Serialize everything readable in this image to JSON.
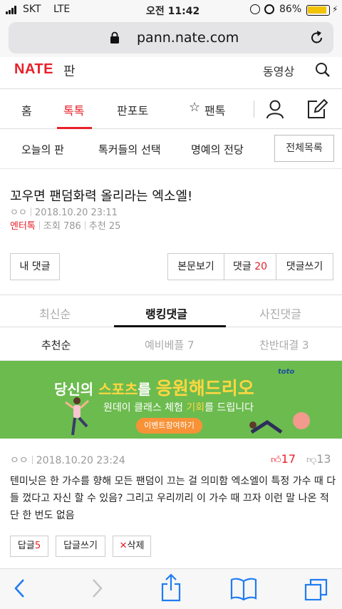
{
  "status": {
    "carrier": "SKT",
    "network": "LTE",
    "time": "오전 11:42",
    "battery": "86%"
  },
  "browser": {
    "url": "pann.nate.com"
  },
  "site": {
    "logo": "NATE",
    "section": "판",
    "video_link": "동영상"
  },
  "nav": {
    "items": [
      "홈",
      "톡톡",
      "판포토",
      "팬톡"
    ],
    "active_index": 1
  },
  "subnav": {
    "items": [
      "오늘의 판",
      "톡커들의 선택",
      "명예의 전당"
    ],
    "all_list": "전체목록"
  },
  "article": {
    "title": "꼬우면 팬덤화력 올리라는 엑소엘!",
    "author": "ㅇㅇ",
    "date": "2018.10.20 23:11",
    "category": "엔터톡",
    "views_label": "조회",
    "views": "786",
    "recommend_label": "추천",
    "recommend": "25"
  },
  "actions": {
    "my_comments": "내 댓글",
    "view_post": "본문보기",
    "comments_label": "댓글",
    "comments_count": "20",
    "write_comment": "댓글쓰기"
  },
  "tabs": {
    "items": [
      "최신순",
      "랭킹댓글",
      "사진댓글"
    ],
    "active_index": 1
  },
  "subtabs": {
    "items": [
      "추천순",
      "예비베플 7",
      "찬반대결 3"
    ]
  },
  "banner": {
    "line1_a": "당신의 ",
    "line1_b": "스포츠",
    "line1_c": "를 ",
    "line1_d": "응원해드리오",
    "line2_a": "원데이 클래스 체험 ",
    "line2_b": "기회",
    "line2_c": "를 드립니다",
    "button": "이벤트참여하기",
    "brand": "toto",
    "colors": {
      "background": "#6cbb4f",
      "accent": "#ffd740",
      "button": "#f79237"
    }
  },
  "comment": {
    "author": "ㅇㅇ",
    "date": "2018.10.20 23:24",
    "likes": "17",
    "dislikes": "13",
    "text": "텐미닛은 한 가수를 향해 모든 팬덤이 끄는 걸 의미함 엑소엘이 특정 가수 때 다들 껐다고 자신 할 수 있음? 그리고 우리끼리 이 가수 때 끄자 이런 말 나온 적 단 한 번도 없음",
    "reply_label": "답글",
    "reply_count": "5",
    "write_reply": "답글쓰기",
    "delete": "삭제"
  },
  "colors": {
    "accent": "#e8202a"
  }
}
